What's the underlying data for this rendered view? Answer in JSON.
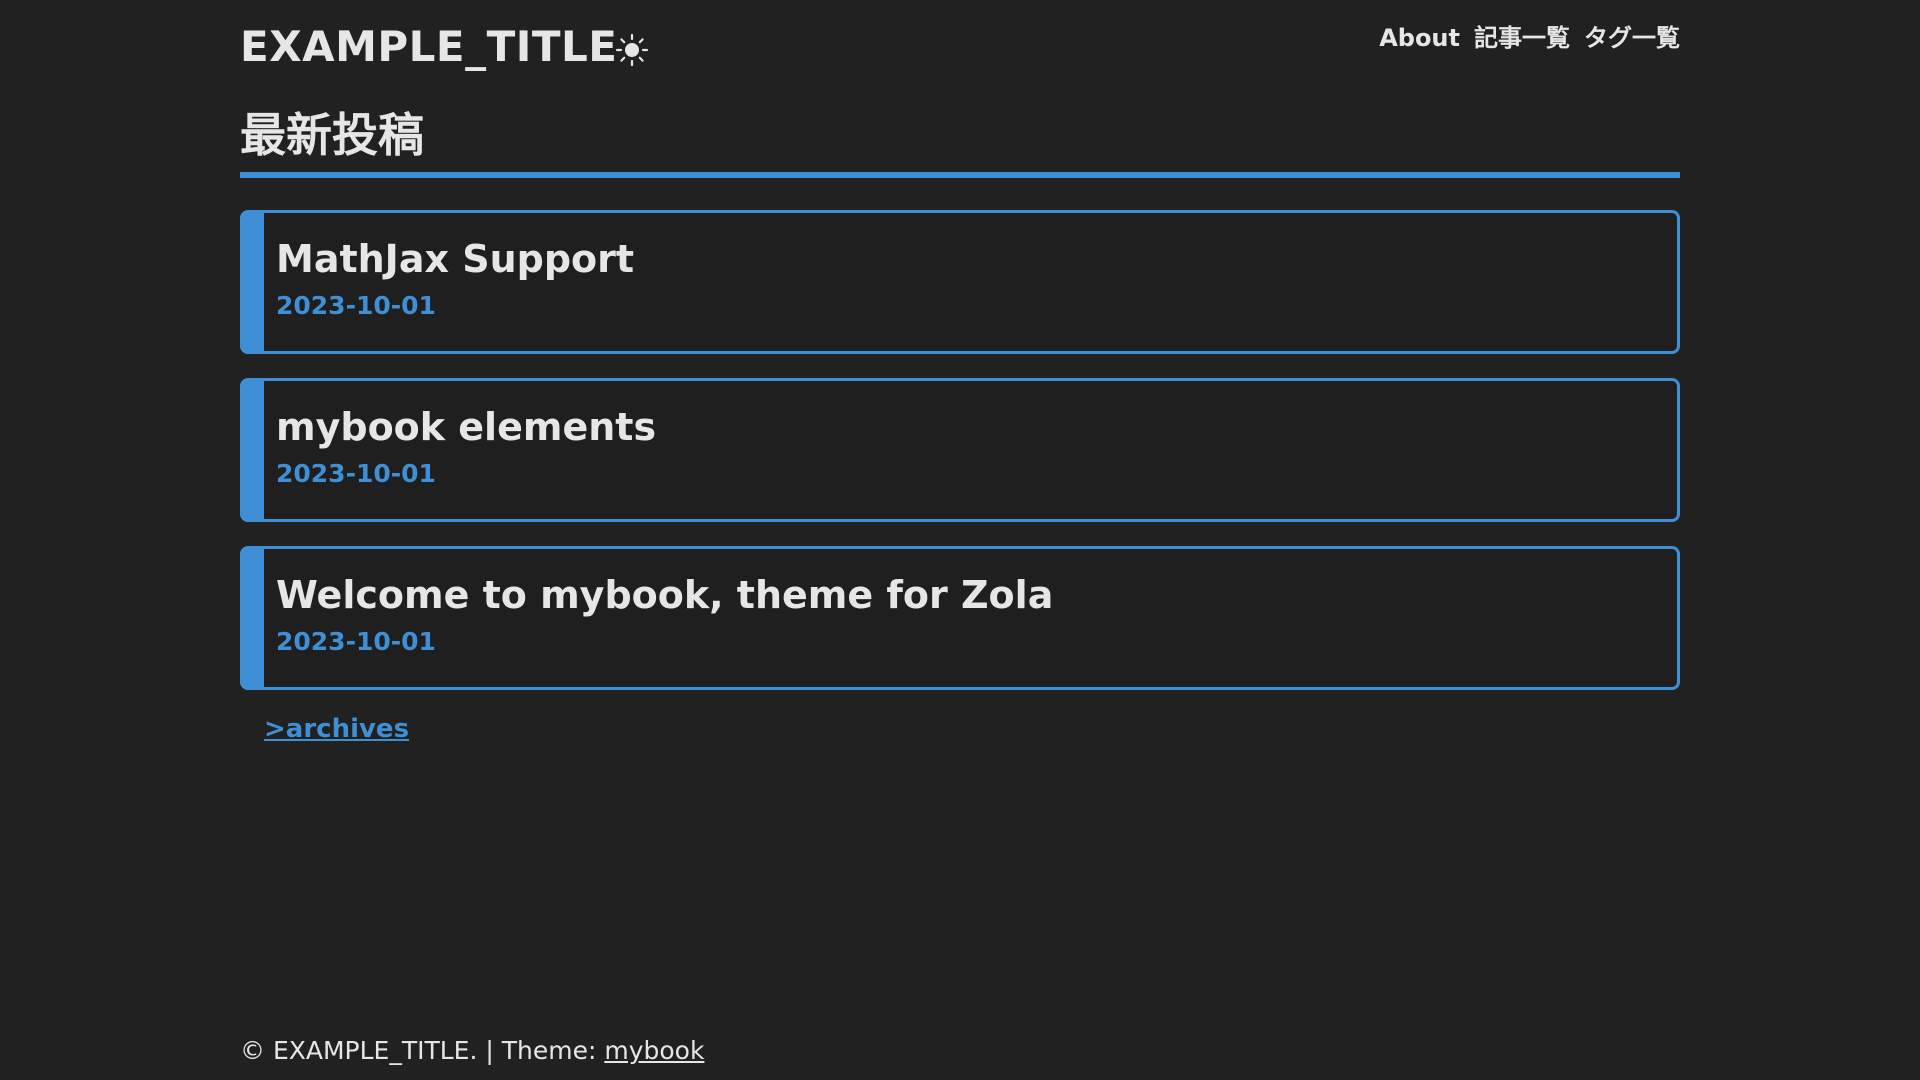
{
  "header": {
    "site_title": "EXAMPLE_TITLE",
    "theme_icon": "sun-icon",
    "nav": [
      {
        "label": "About"
      },
      {
        "label": "記事一覧"
      },
      {
        "label": "タグ一覧"
      }
    ]
  },
  "main": {
    "heading": "最新投稿",
    "posts": [
      {
        "title": "MathJax Support",
        "date": "2023-10-01"
      },
      {
        "title": "mybook elements",
        "date": "2023-10-01"
      },
      {
        "title": "Welcome to mybook, theme for Zola",
        "date": "2023-10-01"
      }
    ],
    "archives_link": ">archives"
  },
  "footer": {
    "copyright": "© EXAMPLE_TITLE. | Theme: ",
    "theme_link": "mybook"
  },
  "colors": {
    "background": "#212121",
    "text": "#e6e6e6",
    "accent": "#3f8fd6"
  }
}
